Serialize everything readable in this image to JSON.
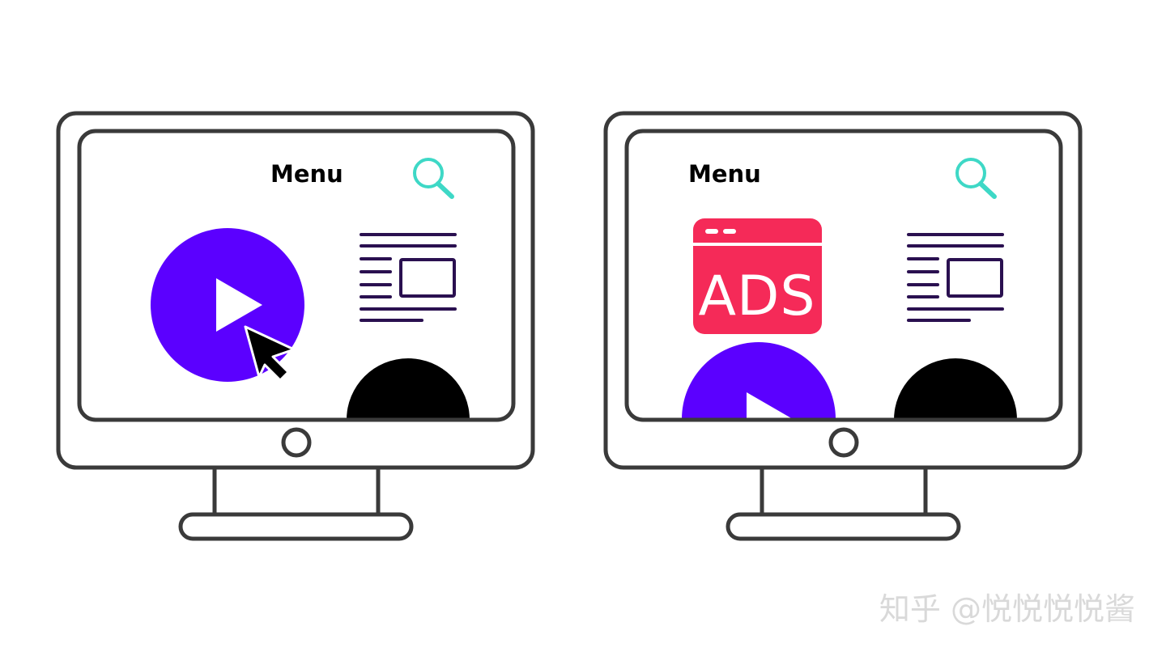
{
  "colors": {
    "outline": "#3a3a3a",
    "search_icon": "#3ed8c6",
    "play_circle": "#5b00ff",
    "article_lines": "#2a1050",
    "ads_badge": "#f52a58",
    "cursor": "#000000",
    "avatar": "#000000"
  },
  "monitors": [
    {
      "menu_label": "Menu",
      "icons": [
        "search-icon",
        "play-button-icon",
        "cursor-icon",
        "article-icon",
        "avatar-icon"
      ]
    },
    {
      "menu_label": "Menu",
      "ads_label": "ADS",
      "icons": [
        "search-icon",
        "ads-icon",
        "play-button-icon",
        "article-icon",
        "avatar-icon"
      ]
    }
  ],
  "watermark": "知乎 @悦悦悦悦酱"
}
